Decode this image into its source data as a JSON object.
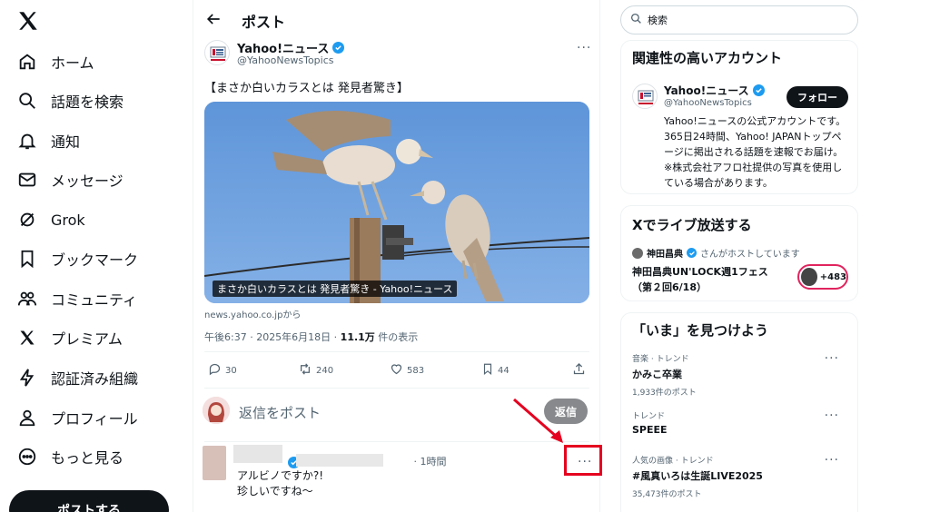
{
  "nav": {
    "items": [
      {
        "label": "ホーム",
        "icon": "home-icon"
      },
      {
        "label": "話題を検索",
        "icon": "search-icon"
      },
      {
        "label": "通知",
        "icon": "bell-icon"
      },
      {
        "label": "メッセージ",
        "icon": "mail-icon"
      },
      {
        "label": "Grok",
        "icon": "grok-icon"
      },
      {
        "label": "ブックマーク",
        "icon": "bookmark-icon"
      },
      {
        "label": "コミュニティ",
        "icon": "community-icon"
      },
      {
        "label": "プレミアム",
        "icon": "x-premium-icon"
      },
      {
        "label": "認証済み組織",
        "icon": "lightning-icon"
      },
      {
        "label": "プロフィール",
        "icon": "person-icon"
      },
      {
        "label": "もっと見る",
        "icon": "more-circle-icon"
      }
    ],
    "post_button": "ポストする"
  },
  "main": {
    "title": "ポスト",
    "author": {
      "name": "Yahoo!ニュース",
      "handle": "@YahooNewsTopics"
    },
    "text": "【まさか白いカラスとは 発見者驚き】",
    "media_caption": "まさか白いカラスとは 発見者驚き - Yahoo!ニュース",
    "source": "news.yahoo.co.jpから",
    "meta": {
      "time": "午後6:37 · 2025年6月18日 · ",
      "views": "11.1万",
      "views_suffix": " 件の表示"
    },
    "actions": {
      "replies": "30",
      "reposts": "240",
      "likes": "583",
      "bookmarks": "44"
    },
    "reply_placeholder": "返信をポスト",
    "reply_button": "返信",
    "comment": {
      "handle_prefix": "@r",
      "time": "· 1時間",
      "lines": [
        "アルビノですか?!",
        "珍しいですね〜"
      ]
    }
  },
  "right": {
    "search_placeholder": "検索",
    "relevant": {
      "title": "関連性の高いアカウント",
      "name": "Yahoo!ニュース",
      "handle": "@YahooNewsTopics",
      "follow": "フォロー",
      "bio": "Yahoo!ニュースの公式アカウントです。365日24時間、Yahoo! JAPANトップページに掲出される話題を速報でお届け。※株式会社アフロ社提供の写真を使用している場合があります。"
    },
    "live": {
      "title": "Xでライブ放送する",
      "host": "神田昌典",
      "host_suffix": "さんがホストしています",
      "event": "神田昌典UN'LOCK週1フェス（第２回6/18）",
      "listeners": "+483"
    },
    "trends": {
      "title": "「いま」を見つけよう",
      "items": [
        {
          "category": "音楽 · トレンド",
          "name": "かみこ卒業",
          "count": "1,933件のポスト"
        },
        {
          "category": "トレンド",
          "name": "SPEEE",
          "count": ""
        },
        {
          "category": "人気の画像 · トレンド",
          "name": "#風真いろは生誕LIVE2025",
          "count": "35,473件のポスト"
        }
      ]
    }
  },
  "colors": {
    "accent": "#1d9bf0",
    "highlight": "#e5001f",
    "text": "#0f1419",
    "muted": "#536471"
  }
}
